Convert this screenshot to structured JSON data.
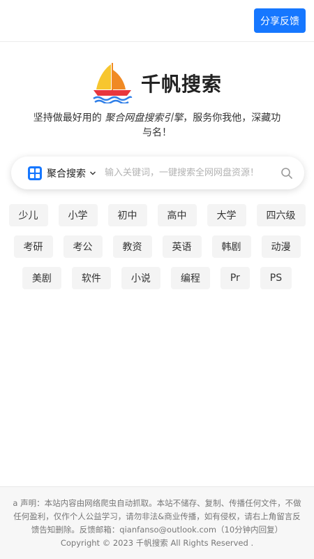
{
  "header": {
    "feedback_label": "分享反馈"
  },
  "brand": {
    "name": "千帆搜索",
    "icon": "sailboat-logo"
  },
  "slogan": {
    "prefix": "坚持做最好用的 ",
    "emphasis": "聚合网盘搜索引擎",
    "suffix": "，服务你我他，深藏功与名！"
  },
  "search": {
    "engine_label": "聚合搜索",
    "placeholder": "输入关键词，一键搜索全网网盘资源！",
    "value": "",
    "icons": {
      "engine": "grid-icon",
      "dropdown": "chevron-down-icon",
      "submit": "search-icon"
    },
    "accent": "#1677ff"
  },
  "tags": [
    [
      "少儿",
      "小学",
      "初中",
      "高中",
      "大学",
      "四六级"
    ],
    [
      "考研",
      "考公",
      "教资",
      "英语",
      "韩剧",
      "动漫"
    ],
    [
      "美剧",
      "软件",
      "小说",
      "编程",
      "Pr",
      "PS"
    ]
  ],
  "footer": {
    "disclaimer": "a 声明：本站内容由网络爬虫自动抓取。本站不储存、复制、传播任何文件，不做任何盈利，仅作个人公益学习，请勿非法&商业传播，如有侵权，请右上角留言反馈告知删除。反馈邮箱：qianfanso@outlook.com（10分钟内回复）",
    "copyright": "Copyright © 2023 千帆搜索 All Rights Reserved ."
  }
}
